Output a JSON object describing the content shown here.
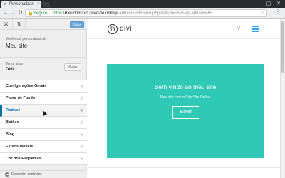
{
  "browser": {
    "tab_title": "Personalizar: Meu si",
    "secure_label": "Seguro",
    "url_scheme": "https://",
    "url_host": "meudominio.criarsite.online",
    "url_path": "/wp-admin/customize.php?return=%2Fwp-admin%2F"
  },
  "sidebar": {
    "publish_label": "Salvo",
    "customizing_label": "Você está personalizando",
    "site_name": "Meu site",
    "theme_label": "Tema ativo",
    "theme_name": "Divi",
    "change_label": "Mudar",
    "panels": [
      {
        "label": "Configurações Gerais"
      },
      {
        "label": "Plano de Fundo"
      },
      {
        "label": "Rodapé"
      },
      {
        "label": "Botões"
      },
      {
        "label": "Blog"
      },
      {
        "label": "Estilos Móveis"
      },
      {
        "label": "Cor dos Esquemas"
      }
    ],
    "active_panel": "Rodapé",
    "collapse_label": "Esconder controles"
  },
  "preview": {
    "logo_letter": "D",
    "logo_text": "divi",
    "hero_title": "Bem vindo ao meu site",
    "hero_subtitle": "Meu site com o CriarSite.Online",
    "hero_button": "Enter"
  },
  "colors": {
    "hero_bg": "#2fc9b5",
    "accent": "#0073aa",
    "publish_bg": "#6aa7d9",
    "menu_accent": "#2ea3f2"
  },
  "icons": {
    "close": "close-icon",
    "sort": "sort-icon",
    "chevron": "chevron-right-icon",
    "search": "search-icon",
    "hamburger": "hamburger-icon"
  }
}
